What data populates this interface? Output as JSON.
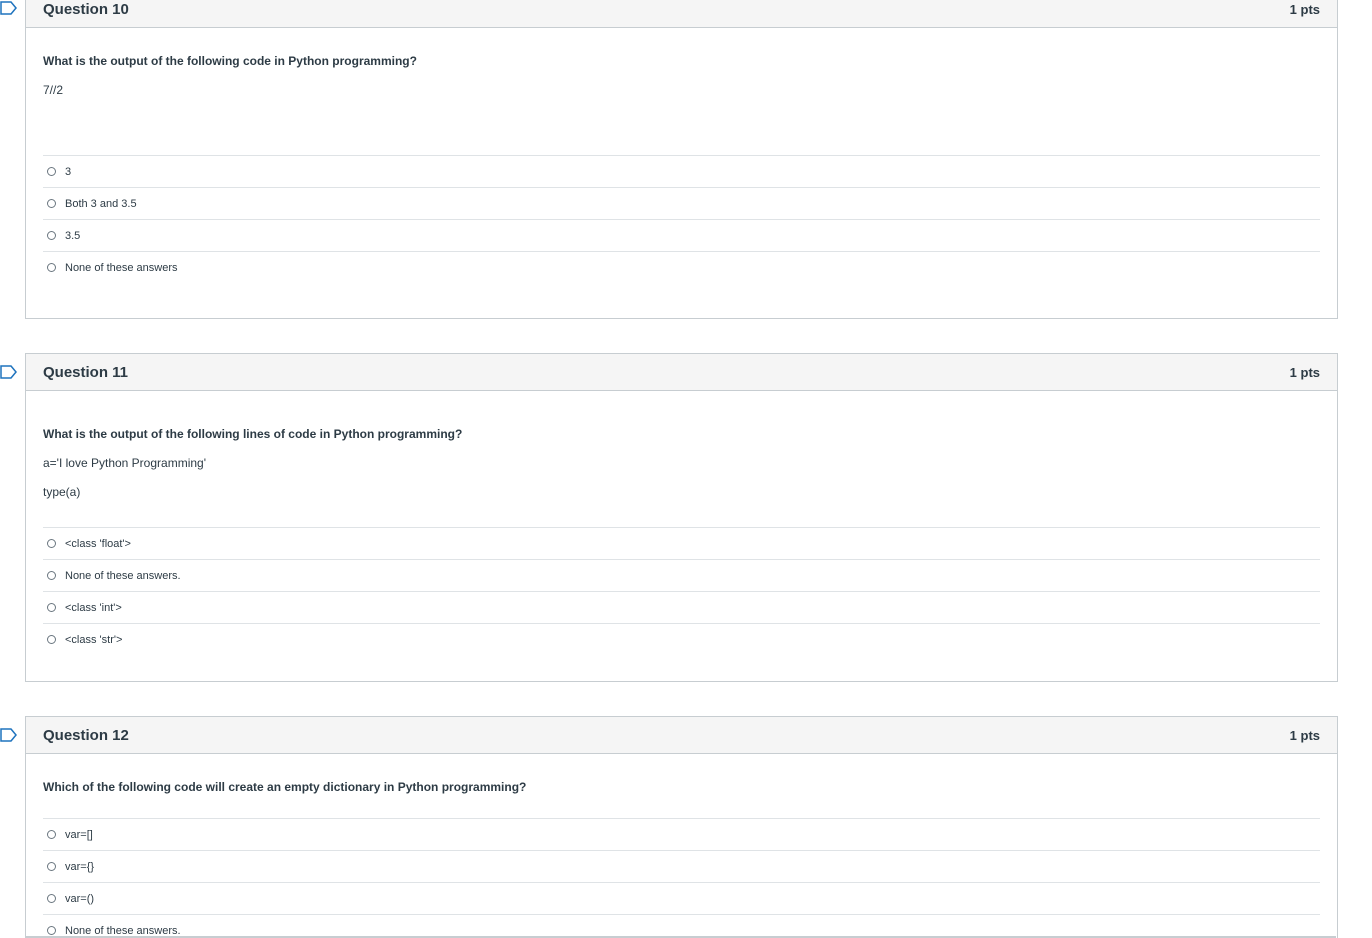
{
  "questions": [
    {
      "title": "Question 10",
      "points": "1 pts",
      "text": "What is the output of the following code in Python programming?",
      "code": [
        "7//2"
      ],
      "answers": [
        "3",
        "Both 3 and 3.5",
        "3.5",
        "None of these answers"
      ]
    },
    {
      "title": "Question 11",
      "points": "1 pts",
      "text": "What is the output of the following lines of code in Python programming?",
      "code": [
        "a='I love Python Programming'",
        "type(a)"
      ],
      "answers": [
        "<class 'float'>",
        "None of these answers.",
        "<class 'int'>",
        "<class 'str'>"
      ]
    },
    {
      "title": "Question 12",
      "points": "1 pts",
      "text": "Which of the following code will create an empty dictionary in Python programming?",
      "code": [],
      "answers": [
        "var=[]",
        "var={}",
        "var=()",
        "None of these answers."
      ]
    }
  ],
  "colors": {
    "border": "#c7cdd1",
    "header_bg": "#f5f5f5",
    "text": "#2d3b45",
    "bookmark": "#1e73be"
  }
}
